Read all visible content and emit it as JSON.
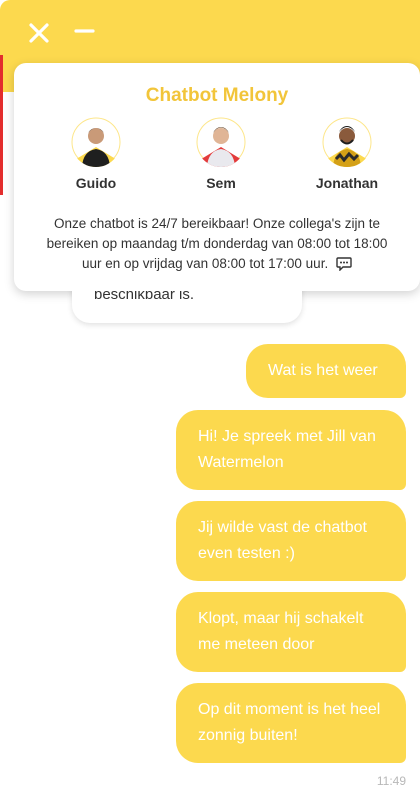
{
  "header": {
    "close_icon": "close-icon",
    "minimize_icon": "minimize-icon",
    "accent_color": "#fcd94e"
  },
  "team": {
    "title": "Chatbot Melony",
    "members": [
      {
        "name": "Guido",
        "avatar": "avatar-guido"
      },
      {
        "name": "Sem",
        "avatar": "avatar-sem"
      },
      {
        "name": "Jonathan",
        "avatar": "avatar-jonathan"
      }
    ],
    "info": "Onze chatbot is 24/7 bereikbaar! Onze collega's zijn te bereiken op maandag t/m donderdag van 08:00 tot 18:00 uur en op vrijdag van 08:00 tot 17:00 uur.",
    "info_icon": "chat-icon"
  },
  "messages": {
    "partial_bot": "beschikbaar is.",
    "items": [
      {
        "from": "user",
        "text": "Wat is het weer"
      },
      {
        "from": "user",
        "text": "Hi! Je spreek met Jill van Watermelon"
      },
      {
        "from": "user",
        "text": "Jij wilde vast de chatbot even testen :)"
      },
      {
        "from": "user",
        "text": "Klopt, maar hij schakelt me meteen door"
      },
      {
        "from": "user",
        "text": "Op dit moment is het heel zonnig buiten!"
      }
    ],
    "timestamp": "11:49"
  }
}
